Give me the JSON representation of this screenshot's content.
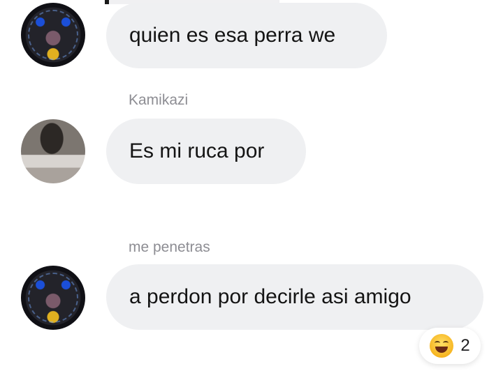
{
  "messages": [
    {
      "sender": "",
      "text": "quien es esa perra we",
      "avatar": "avatar-dark-poster"
    },
    {
      "sender": "Kamikazi",
      "text": "Es mi ruca por",
      "avatar": "avatar-photo"
    },
    {
      "sender": "me penetras",
      "text": "a perdon por decirle asi amigo",
      "avatar": "avatar-dark-poster"
    }
  ],
  "reaction": {
    "emoji": "grinning-squinting-face",
    "count": "2"
  },
  "colors": {
    "bubble": "#eff0f2",
    "sender_name": "#8d8d93",
    "text": "#141414"
  }
}
